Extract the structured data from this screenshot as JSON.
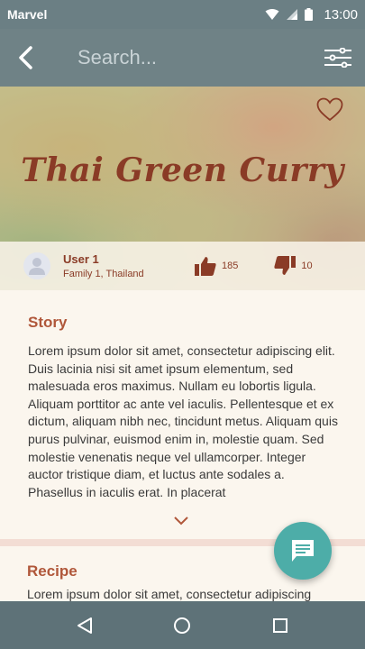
{
  "status_bar": {
    "carrier": "Marvel",
    "time": "13:00"
  },
  "app_bar": {
    "search_placeholder": "Search..."
  },
  "hero": {
    "title": "Thai Green Curry",
    "user": {
      "name": "User 1",
      "location": "Family 1, Thailand"
    },
    "likes": "185",
    "dislikes": "10"
  },
  "story": {
    "heading": "Story",
    "text": "Lorem ipsum dolor sit amet, consectetur adipiscing elit. Duis lacinia nisi sit amet ipsum elementum, sed malesuada eros maximus. Nullam eu lobortis ligula. Aliquam porttitor ac ante vel iaculis. Pellentesque et ex dictum, aliquam nibh nec, tincidunt metus. Aliquam quis purus pulvinar, euismod enim in, molestie quam. Sed molestie venenatis neque vel ullamcorper. Integer auctor tristique diam, et luctus ante sodales a. Phasellus in iaculis erat. In placerat"
  },
  "recipe": {
    "heading": "Recipe",
    "text": "Lorem ipsum dolor sit amet, consectetur adipiscing"
  },
  "colors": {
    "appbar": "#6f8286",
    "accent": "#8a3b26",
    "fab": "#4dada8",
    "heading": "#b0573a"
  },
  "icons": [
    "wifi-icon",
    "signal-icon",
    "battery-icon",
    "back-arrow-icon",
    "filter-sliders-icon",
    "heart-icon",
    "avatar-person-icon",
    "thumbs-up-icon",
    "thumbs-down-icon",
    "chevron-down-icon",
    "chat-icon",
    "nav-back-icon",
    "nav-home-icon",
    "nav-recents-icon"
  ]
}
